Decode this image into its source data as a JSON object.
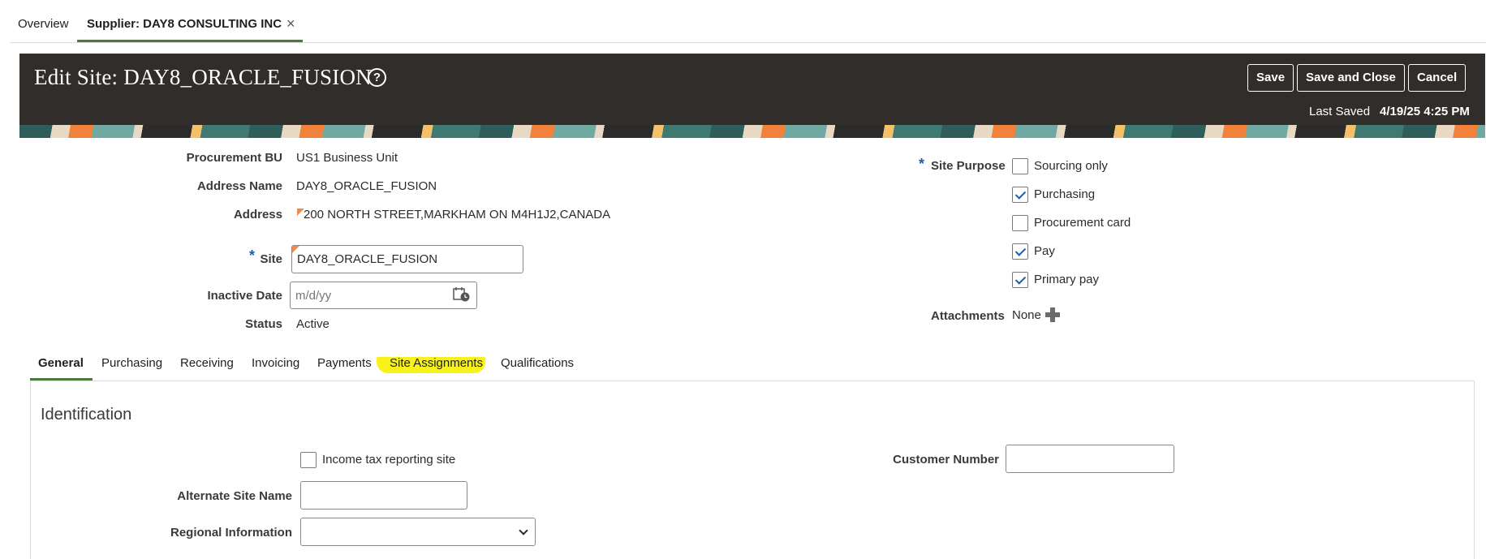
{
  "top_tabs": {
    "overview": "Overview",
    "supplier": "Supplier: DAY8 CONSULTING INC",
    "close_glyph": "×"
  },
  "header": {
    "title": "Edit Site: DAY8_ORACLE_FUSION",
    "help_glyph": "?",
    "save": "Save",
    "save_and_close": "Save and Close",
    "cancel": "Cancel",
    "last_saved_label": "Last Saved",
    "last_saved_value": "4/19/25 4:25 PM"
  },
  "form": {
    "procurement_bu_label": "Procurement BU",
    "procurement_bu_value": "US1 Business Unit",
    "address_name_label": "Address Name",
    "address_name_value": "DAY8_ORACLE_FUSION",
    "address_label": "Address",
    "address_value": "200 NORTH STREET,MARKHAM ON M4H1J2,CANADA",
    "site_label": "Site",
    "site_value": "DAY8_ORACLE_FUSION",
    "inactive_date_label": "Inactive Date",
    "inactive_date_placeholder": "m/d/yy",
    "status_label": "Status",
    "status_value": "Active",
    "required_mark": "*"
  },
  "site_purpose": {
    "label": "Site Purpose",
    "options": [
      {
        "label": "Sourcing only",
        "checked": false
      },
      {
        "label": "Purchasing",
        "checked": true
      },
      {
        "label": "Procurement card",
        "checked": false
      },
      {
        "label": "Pay",
        "checked": true
      },
      {
        "label": "Primary pay",
        "checked": true
      }
    ]
  },
  "attachments": {
    "label": "Attachments",
    "value": "None",
    "add_glyph": "+"
  },
  "tabs": [
    {
      "label": "General",
      "active": true
    },
    {
      "label": "Purchasing"
    },
    {
      "label": "Receiving"
    },
    {
      "label": "Invoicing"
    },
    {
      "label": "Payments"
    },
    {
      "label": "Site Assignments",
      "highlighted": true
    },
    {
      "label": "Qualifications"
    }
  ],
  "identification": {
    "title": "Identification",
    "income_tax_label": "Income tax reporting site",
    "alternate_site_name_label": "Alternate Site Name",
    "alternate_site_name_value": "",
    "regional_information_label": "Regional Information",
    "regional_information_value": "",
    "customer_number_label": "Customer Number",
    "customer_number_value": ""
  },
  "colors": {
    "header_bg": "#312d2a",
    "accent_green": "#4a7a3d",
    "required_blue": "#1f5fa6",
    "highlight_yellow": "#f6f21a"
  }
}
